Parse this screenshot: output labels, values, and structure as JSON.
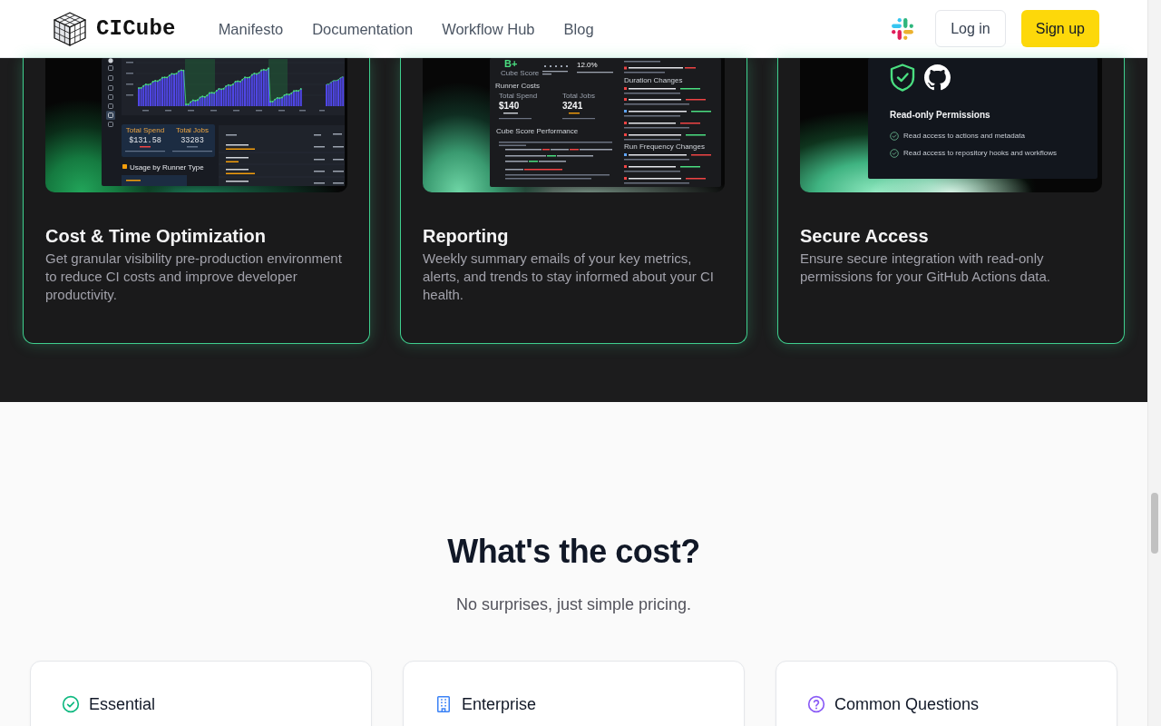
{
  "header": {
    "logo": "CICube",
    "nav": [
      {
        "label": "Manifesto"
      },
      {
        "label": "Documentation"
      },
      {
        "label": "Workflow Hub"
      },
      {
        "label": "Blog"
      }
    ],
    "login": "Log in",
    "signup": "Sign up"
  },
  "features": [
    {
      "kind": "costs",
      "title": "Cost & Time Optimization",
      "description": "Get granular visibility pre-production environment to reduce CI costs and improve developer productivity.",
      "preview": {
        "stats": [
          {
            "label": "Total Spend",
            "value": "$131.58"
          },
          {
            "label": "Total Jobs",
            "value": "33283"
          }
        ],
        "section": "Usage by Runner Type"
      }
    },
    {
      "kind": "report",
      "title": "Reporting",
      "description": "Weekly summary emails of your key metrics, alerts, and trends to stay informed about your CI health.",
      "preview": {
        "grade": "B+",
        "grade_label": "Cube Score",
        "change": "12.0%",
        "costs_heading": "Runner Costs",
        "stats": [
          {
            "label": "Total Spend",
            "value": "$140"
          },
          {
            "label": "Total Jobs",
            "value": "3241"
          }
        ],
        "performance_heading": "Cube Score Performance",
        "change_headings": [
          "Duration Changes",
          "Run Frequency Changes"
        ]
      }
    },
    {
      "kind": "security",
      "title": "Secure Access",
      "description": "Ensure secure integration with read-only permissions for your GitHub Actions data.",
      "preview": {
        "heading": "Read-only Permissions",
        "items": [
          "Read access to actions and metadata",
          "Read access to repository hooks and workflows"
        ]
      }
    }
  ],
  "pricing": {
    "title": "What's the cost?",
    "subtitle": "No surprises, just simple pricing.",
    "cards": [
      {
        "kind": "check",
        "title": "Essential",
        "color": "#10b981"
      },
      {
        "kind": "building",
        "title": "Enterprise",
        "color": "#3b82f6"
      },
      {
        "kind": "question",
        "title": "Common Questions",
        "color": "#8b5cf6"
      }
    ]
  }
}
